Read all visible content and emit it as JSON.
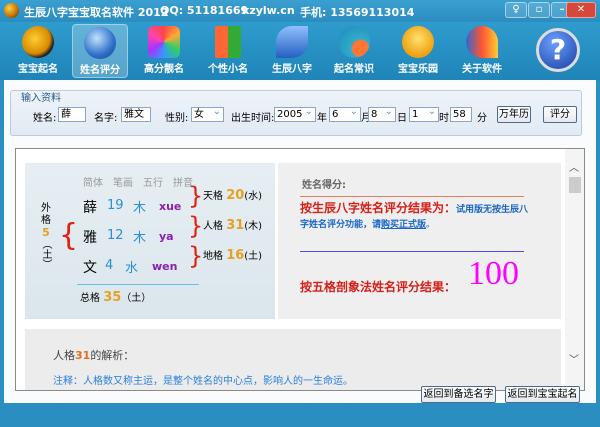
{
  "titlebar": {
    "title": "生辰八字宝宝取名软件 2012",
    "qq": "QQ: 51181669",
    "site": "kzylw.cn",
    "phone": "手机: 13569113014"
  },
  "toolbar": [
    {
      "label": "宝宝起名",
      "icon": "yin-yang-icon"
    },
    {
      "label": "姓名评分",
      "icon": "globe-icon"
    },
    {
      "label": "高分靓名",
      "icon": "hexagons-icon"
    },
    {
      "label": "个性小名",
      "icon": "office-icon"
    },
    {
      "label": "生辰八字",
      "icon": "wings-icon"
    },
    {
      "label": "起名常识",
      "icon": "orb-icon"
    },
    {
      "label": "宝宝乐园",
      "icon": "chick-icon"
    },
    {
      "label": "关于软件",
      "icon": "butterfly-icon"
    },
    {
      "label": "?",
      "icon": "help-icon"
    }
  ],
  "input": {
    "group": "输入资料",
    "surname_label": "姓名:",
    "surname": "薛",
    "given_label": "名字:",
    "given": "雅文",
    "gender_label": "性别:",
    "gender": "女",
    "birth_label": "出生时间:",
    "year": "2005",
    "year_u": "年",
    "month": "6",
    "month_u": "月",
    "day": "8",
    "day_u": "日",
    "hour": "1",
    "hour_u": "时",
    "minute": "58",
    "minute_u": "分",
    "calendar_btn": "万年历",
    "score_btn": "评分"
  },
  "analysis": {
    "headers": [
      "简体",
      "笔画",
      "五行",
      "拼音"
    ],
    "rows": [
      {
        "char": "薛",
        "strokes": "19",
        "element": "木",
        "pinyin": "xue"
      },
      {
        "char": "雅",
        "strokes": "12",
        "element": "木",
        "pinyin": "ya"
      },
      {
        "char": "文",
        "strokes": "4",
        "element": "水",
        "pinyin": "wen"
      }
    ],
    "waige": {
      "label": "外格",
      "value": "5",
      "element": "（土）"
    },
    "tiange": {
      "label": "天格",
      "value": "20",
      "element": "(水)"
    },
    "renge": {
      "label": "人格",
      "value": "31",
      "element": "(木)"
    },
    "dige": {
      "label": "地格",
      "value": "16",
      "element": "(土)"
    },
    "zongge": {
      "label": "总格",
      "value": "35",
      "element": "（土）"
    }
  },
  "score": {
    "title": "姓名得分:",
    "bazi_label": "按生辰八字姓名评分结果为：",
    "bazi_note": "试用版无按生辰八字姓名评分功能，请",
    "buy_link": "购买正式版",
    "bazi_end": "。",
    "wuge_label": "按五格剖象法姓名评分结果：",
    "wuge_score": "100"
  },
  "detail": {
    "title_pre": "人格",
    "title_num": "31",
    "title_post": "的解析：",
    "note": "注释：人格数又称主运，是整个姓名的中心点，影响人的一生命运。"
  },
  "buttons": {
    "back_candidates": "返回到备选名字",
    "back_naming": "返回到宝宝起名"
  }
}
